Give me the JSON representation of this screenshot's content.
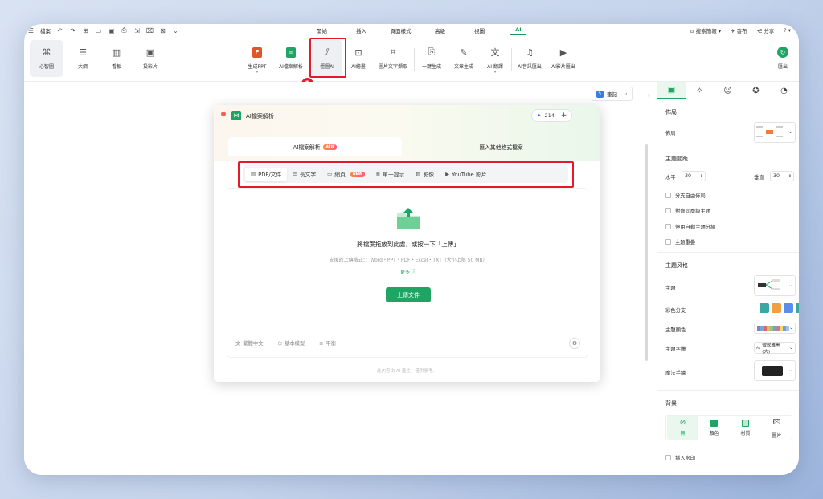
{
  "menubar": {
    "file_label": "檔案",
    "tabs": [
      "開始",
      "插入",
      "頁面樣式",
      "高級",
      "視圖",
      "AI"
    ],
    "right": {
      "search_label": "搜索簡報",
      "publish_label": "發布",
      "share_label": "分享",
      "help_label": "?"
    }
  },
  "ribbon": {
    "views": [
      "心智圖",
      "大綱",
      "看板",
      "投影片"
    ],
    "tools": [
      "生成PPT",
      "AI檔案解析",
      "僵圖AI",
      "AI繪畫",
      "圖片文字擷取",
      "一鍵生成",
      "文章生成",
      "AI 翻譯",
      "AI音訊匯出",
      "AI影片匯出"
    ],
    "export_label": "匯出",
    "step1": "1"
  },
  "canvas": {
    "notes_label": "筆記"
  },
  "dialog": {
    "title": "AI檔案解析",
    "credits": "214",
    "tabs": [
      "AI檔案解析",
      "匯入其他格式檔案"
    ],
    "new_tag": "NEW",
    "subtabs": [
      "PDF/文件",
      "長文字",
      "網頁",
      "單一提示",
      "影像",
      "YouTube 影片"
    ],
    "step2": "2",
    "drop_title": "將檔案拖放到此處，或按一下「上傳」",
    "drop_sub": "支援的上傳格式：：Word・PPT・PDF・Excel・TXT（大小上限 50 MB）",
    "more": "更多",
    "upload_button": "上傳文件",
    "footer": [
      "繁體中文",
      "基本模型",
      "平衡"
    ],
    "disclaimer": "此內容由 AI 產生，僅供參考。"
  },
  "panel": {
    "layout_section": "佈局",
    "layout_label": "佈局",
    "spacing_section": "主題間距",
    "horizontal_label": "水平",
    "horizontal_value": "30",
    "vertical_label": "垂直",
    "vertical_value": "30",
    "checks": [
      "分支自由佈局",
      "對齊同層級主題",
      "停用自動主題分組",
      "主題重疊"
    ],
    "style_section": "主題风格",
    "theme_label": "主題",
    "rainbow_label": "彩色分支",
    "theme_color_label": "主題顏色",
    "theme_font_label": "主題字體",
    "theme_font_value": "微軟雅黑 (大)",
    "hand_drawn_label": "魔法手繪",
    "bg_section": "背景",
    "bg_options": [
      "無",
      "顏色",
      "材質",
      "圖片"
    ],
    "watermark_label": "插入水印"
  },
  "colors": {
    "accent": "#1fa563",
    "highlight": "#e8182c",
    "palette": [
      "#8e7cc3",
      "#6fa8dc",
      "#e06666",
      "#f6b26b",
      "#93c47d",
      "#76a5af",
      "#c27ba0",
      "#ffd966",
      "#6d9eeb",
      "#a4c2f4",
      "#f9cb9c",
      "#b6d7a8"
    ]
  }
}
